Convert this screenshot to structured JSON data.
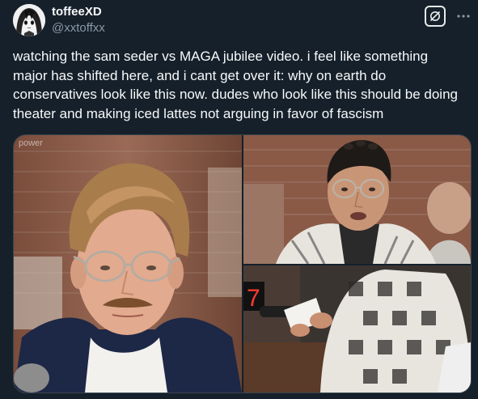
{
  "author": {
    "display_name": "toffeeXD",
    "handle": "@xxtoffxx",
    "avatar_icon": "anime-avatar-icon"
  },
  "actions": {
    "grok_icon": "grok-icon",
    "more_icon": "more-dots-icon"
  },
  "tweet": {
    "text": "watching the sam seder vs MAGA jubilee video. i feel like something major has shifted here, and i cant get over it: why on earth do conservatives look like this now. dudes who look like this should be doing theater and making iced lattes not arguing in favor of fascism"
  },
  "media": {
    "watermark": "power"
  },
  "colors": {
    "background": "#15202b",
    "text": "#f7f9f9",
    "secondary_text": "#8b98a5",
    "border": "#38444d"
  }
}
